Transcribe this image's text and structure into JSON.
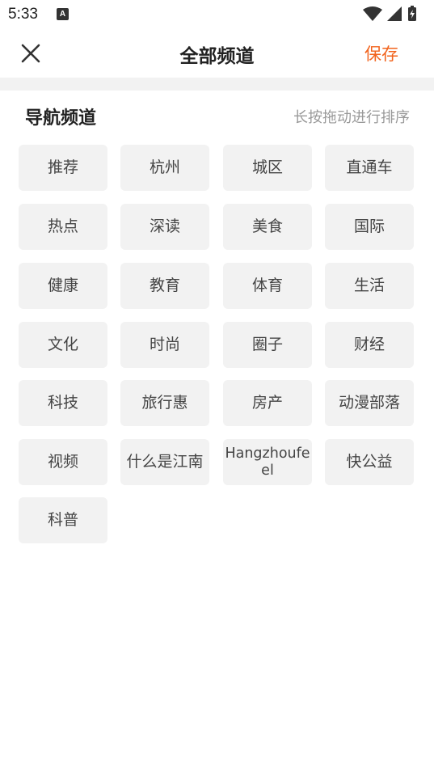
{
  "status_bar": {
    "time": "5:33",
    "notification_glyph": "A"
  },
  "header": {
    "title": "全部频道",
    "save_label": "保存"
  },
  "section": {
    "title": "导航频道",
    "hint": "长按拖动进行排序"
  },
  "channels": [
    "推荐",
    "杭州",
    "城区",
    "直通车",
    "热点",
    "深读",
    "美食",
    "国际",
    "健康",
    "教育",
    "体育",
    "生活",
    "文化",
    "时尚",
    "圈子",
    "财经",
    "科技",
    "旅行惠",
    "房产",
    "动漫部落",
    "视频",
    "什么是江南",
    "Hangzhoufeel",
    "快公益",
    "科普"
  ],
  "colors": {
    "accent": "#f2641e",
    "chip_bg": "#f2f2f2",
    "divider": "#f2f2f2"
  }
}
